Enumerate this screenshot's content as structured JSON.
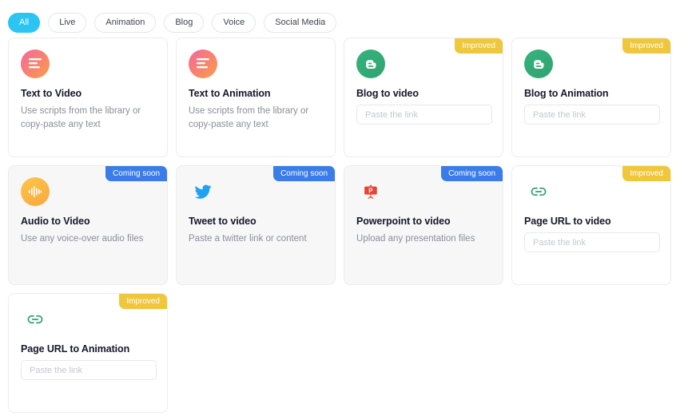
{
  "filters": {
    "items": [
      {
        "label": "All",
        "active": true
      },
      {
        "label": "Live",
        "active": false
      },
      {
        "label": "Animation",
        "active": false
      },
      {
        "label": "Blog",
        "active": false
      },
      {
        "label": "Voice",
        "active": false
      },
      {
        "label": "Social Media",
        "active": false
      }
    ],
    "active_color": "#2bc4f3"
  },
  "badges": {
    "improved": "Improved",
    "coming_soon": "Coming soon",
    "improved_color": "#efc73c",
    "coming_soon_color": "#3b7de8"
  },
  "cards": [
    {
      "title": "Text to Video",
      "description": "Use scripts from the library or copy-paste any text",
      "icon": "text-lines-icon",
      "badge": null,
      "input_placeholder": null,
      "muted": false
    },
    {
      "title": "Text to Animation",
      "description": "Use scripts from the library or copy-paste any text",
      "icon": "text-lines-icon",
      "badge": null,
      "input_placeholder": null,
      "muted": false
    },
    {
      "title": "Blog to video",
      "description": null,
      "icon": "blogger-icon",
      "badge": "Improved",
      "input_placeholder": "Paste the link",
      "muted": false
    },
    {
      "title": "Blog to Animation",
      "description": null,
      "icon": "blogger-icon",
      "badge": "Improved",
      "input_placeholder": "Paste the link",
      "muted": false
    },
    {
      "title": "Audio to Video",
      "description": "Use any voice-over audio files",
      "icon": "audio-waveform-icon",
      "badge": "Coming soon",
      "input_placeholder": null,
      "muted": true
    },
    {
      "title": "Tweet to video",
      "description": "Paste a twitter link or content",
      "icon": "twitter-icon",
      "badge": "Coming soon",
      "input_placeholder": null,
      "muted": true
    },
    {
      "title": "Powerpoint to video",
      "description": "Upload any presentation files",
      "icon": "powerpoint-icon",
      "badge": "Coming soon",
      "input_placeholder": null,
      "muted": true
    },
    {
      "title": "Page URL to video",
      "description": null,
      "icon": "link-icon",
      "badge": "Improved",
      "input_placeholder": "Paste the link",
      "muted": false
    },
    {
      "title": "Page URL to Animation",
      "description": null,
      "icon": "link-icon",
      "badge": "Improved",
      "input_placeholder": "Paste the link",
      "muted": false
    }
  ]
}
